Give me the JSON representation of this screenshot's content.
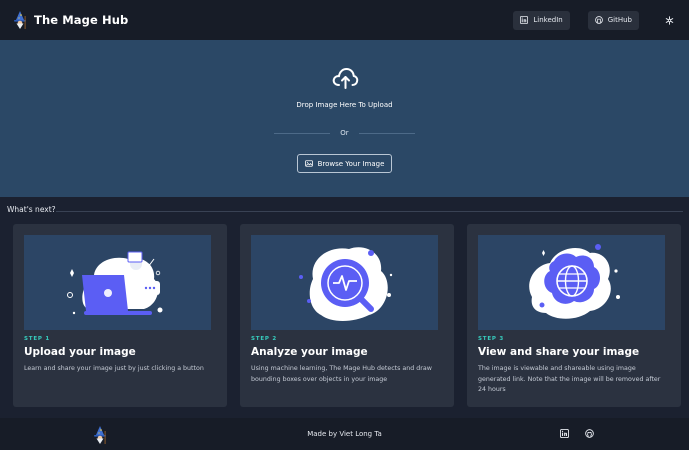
{
  "header": {
    "title": "The Mage Hub",
    "logo_icon": "wizard-icon",
    "links": [
      {
        "label": "LinkedIn",
        "icon": "linkedin-icon"
      },
      {
        "label": "GitHub",
        "icon": "github-icon"
      }
    ],
    "theme_icon": "snowflake-icon"
  },
  "upload": {
    "icon": "cloud-upload-icon",
    "drop_text": "Drop Image Here To Upload",
    "or_text": "Or",
    "browse_label": "Browse Your Image",
    "browse_icon": "image-icon"
  },
  "section": {
    "title": "What's next?"
  },
  "cards": [
    {
      "step": "STEP 1",
      "title": "Upload your image",
      "description": "Learn and share your image just by just clicking a button",
      "illustration": "laptop-upload-illustration"
    },
    {
      "step": "STEP 2",
      "title": "Analyze your image",
      "description": "Using machine learning, The Mage Hub detects and draw bounding boxes over objects in your image",
      "illustration": "magnifier-analysis-illustration"
    },
    {
      "step": "STEP 3",
      "title": "View and share your image",
      "description": "The image is viewable and shareable using image generated link. Note that the image will be removed after 24 hours",
      "illustration": "globe-share-illustration"
    }
  ],
  "footer": {
    "credit": "Made by Viet Long Ta",
    "icons": [
      "linkedin-icon",
      "github-icon"
    ]
  },
  "colors": {
    "accent": "#5b5ef4",
    "step": "#37cdbe",
    "upload_bg": "#2b4866",
    "card_bg": "#2b3240",
    "header_bg": "#171c27"
  }
}
